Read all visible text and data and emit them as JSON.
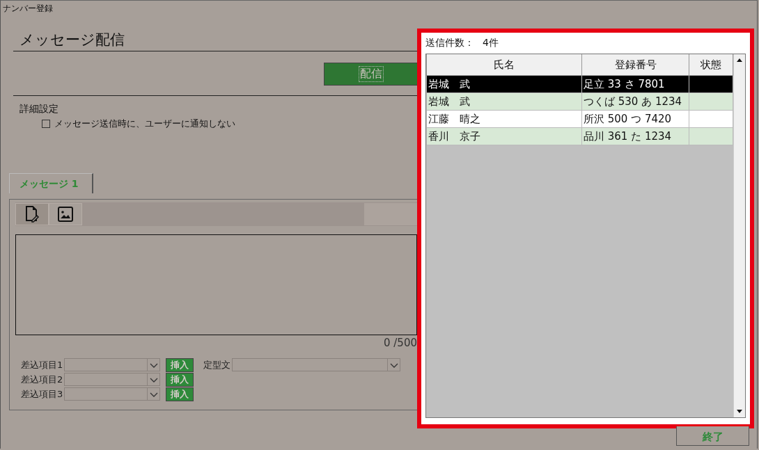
{
  "window": {
    "title": "ナンバー登録"
  },
  "heading": "メッセージ配信",
  "send_button": "配信",
  "details": {
    "title": "詳細設定",
    "options": [
      {
        "label": "メッセージ送信時に、ユーザーに通知しない",
        "checked": false
      }
    ]
  },
  "tabs": [
    {
      "label": "メッセージ 1",
      "selected": true
    }
  ],
  "editor_tools": [
    {
      "kind": "text",
      "selected": true
    },
    {
      "kind": "image",
      "selected": false
    }
  ],
  "char_count": "0 /500",
  "merge_fields": [
    {
      "label": "差込項目1",
      "button": "挿入"
    },
    {
      "label": "差込項目2",
      "button": "挿入"
    },
    {
      "label": "差込項目3",
      "button": "挿入"
    }
  ],
  "template": {
    "label": "定型文"
  },
  "popup": {
    "count_label": "送信件数：",
    "count": "4件",
    "table": {
      "columns": [
        "氏名",
        "登録番号",
        "状態"
      ],
      "rows": [
        {
          "cells": [
            "岩城　武",
            "足立 33 さ 7801",
            ""
          ],
          "selected": true
        },
        {
          "cells": [
            "岩城　武",
            "つくば 530 あ 1234",
            ""
          ],
          "selected": false
        },
        {
          "cells": [
            "江藤　晴之",
            "所沢 500 つ 7420",
            ""
          ],
          "selected": false
        },
        {
          "cells": [
            "香川　京子",
            "品川 361 た 1234",
            ""
          ],
          "selected": false
        }
      ]
    }
  },
  "exit_button": "終了"
}
